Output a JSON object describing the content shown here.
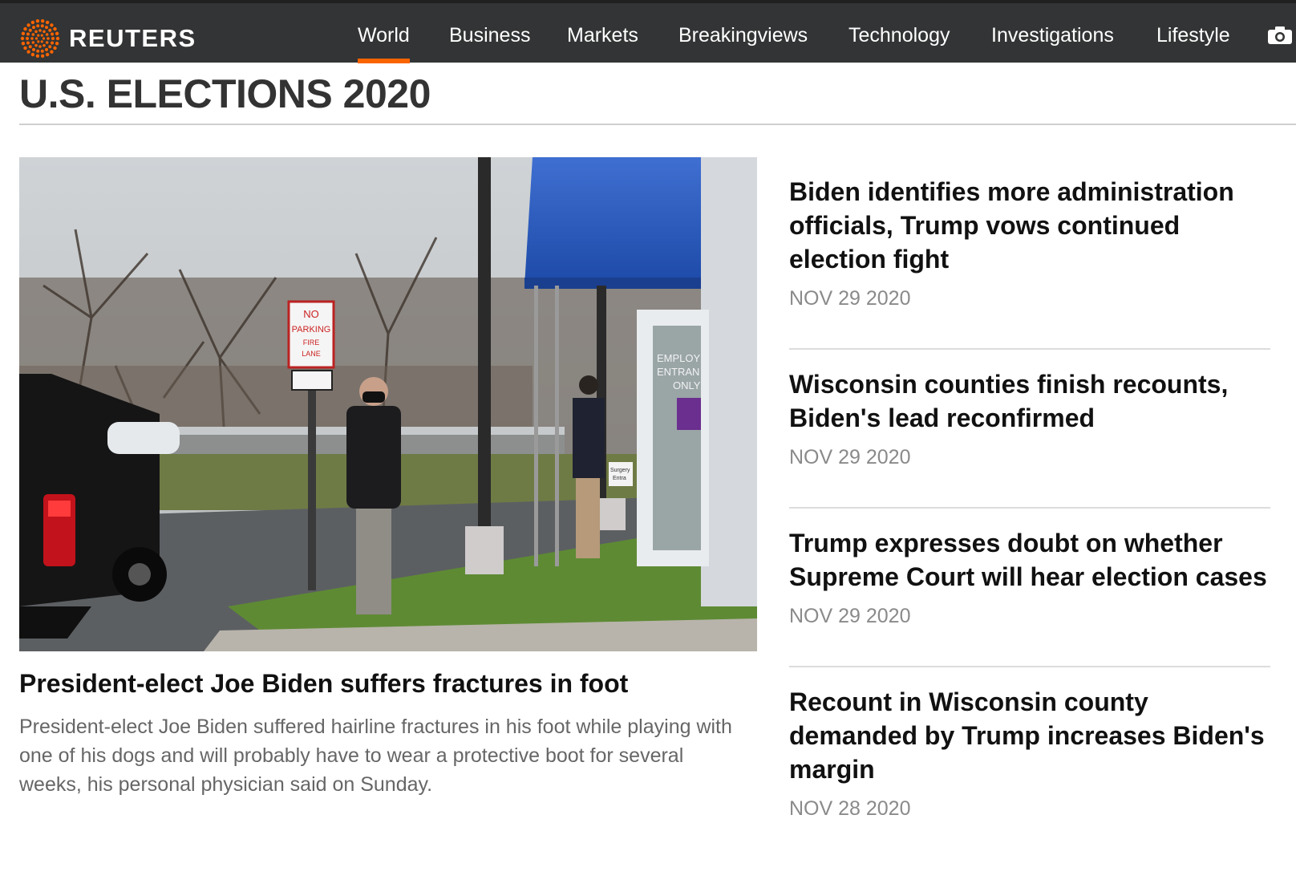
{
  "brand": {
    "name": "REUTERS",
    "accent_color": "#fa6400"
  },
  "nav": {
    "items": [
      {
        "label": "World",
        "active": true
      },
      {
        "label": "Business"
      },
      {
        "label": "Markets"
      },
      {
        "label": "Breakingviews"
      },
      {
        "label": "Technology"
      },
      {
        "label": "Investigations"
      },
      {
        "label": "Lifestyle"
      }
    ],
    "camera_icon": "camera-icon"
  },
  "section": {
    "title": "U.S. ELECTIONS 2020"
  },
  "lead": {
    "headline": "President-elect Joe Biden suffers fractures in foot",
    "summary": "President-elect Joe Biden suffered hairline fractures in his foot while playing with one of his dogs and will probably have to wear a protective boot for several weeks, his personal physician said on Sunday.",
    "photo": {
      "sign_lines": [
        "NO",
        "PARKING",
        "FIRE",
        "LANE"
      ],
      "door_lines": [
        "EMPLOY",
        "ENTRAN",
        "ONLY"
      ],
      "small_sign_lines": [
        "Surgery",
        "Entra"
      ]
    }
  },
  "stories": [
    {
      "title": "Biden identifies more administration officials, Trump vows continued election fight",
      "date": "NOV 29 2020"
    },
    {
      "title": "Wisconsin counties finish recounts, Biden's lead reconfirmed",
      "date": "NOV 29 2020"
    },
    {
      "title": "Trump expresses doubt on whether Supreme Court will hear election cases",
      "date": "NOV 29 2020"
    },
    {
      "title": "Recount in Wisconsin county demanded by Trump increases Biden's margin",
      "date": "NOV 28 2020"
    }
  ]
}
